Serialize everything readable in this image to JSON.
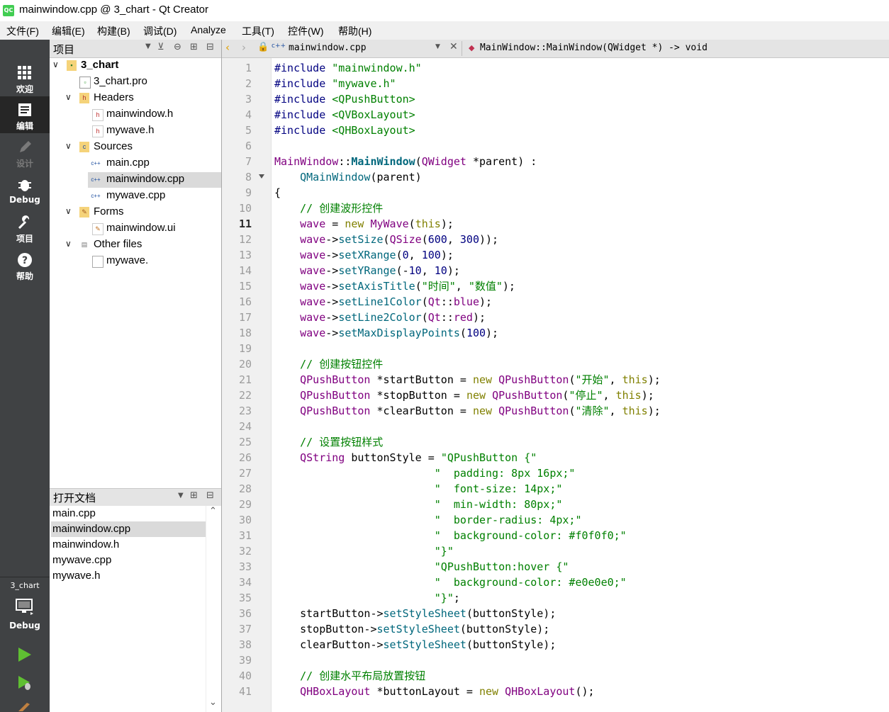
{
  "window": {
    "title": "mainwindow.cpp @ 3_chart - Qt Creator",
    "app_icon": "QC"
  },
  "menu": [
    "文件(F)",
    "编辑(E)",
    "构建(B)",
    "调试(D)",
    "Analyze",
    "工具(T)",
    "控件(W)",
    "帮助(H)"
  ],
  "modes": [
    {
      "label": "欢迎",
      "icon": "grid-icon"
    },
    {
      "label": "编辑",
      "icon": "edit-doc-icon",
      "active": true
    },
    {
      "label": "设计",
      "icon": "pencil-icon",
      "disabled": true
    },
    {
      "label": "Debug",
      "icon": "bug-icon"
    },
    {
      "label": "项目",
      "icon": "wrench-icon"
    },
    {
      "label": "帮助",
      "icon": "help-icon"
    }
  ],
  "kit": {
    "project": "3_chart",
    "build_config": "Debug"
  },
  "project_pane": {
    "title": "项目"
  },
  "tree": [
    {
      "label": "3_chart",
      "type": "project",
      "expanded": true
    },
    {
      "label": "3_chart.pro",
      "type": "pro"
    },
    {
      "label": "Headers",
      "type": "folder",
      "expanded": true
    },
    {
      "label": "mainwindow.h",
      "type": "h"
    },
    {
      "label": "mywave.h",
      "type": "h"
    },
    {
      "label": "Sources",
      "type": "folder",
      "expanded": true
    },
    {
      "label": "main.cpp",
      "type": "cpp"
    },
    {
      "label": "mainwindow.cpp",
      "type": "cpp",
      "selected": true
    },
    {
      "label": "mywave.cpp",
      "type": "cpp"
    },
    {
      "label": "Forms",
      "type": "folder",
      "expanded": true
    },
    {
      "label": "mainwindow.ui",
      "type": "ui"
    },
    {
      "label": "Other files",
      "type": "folder",
      "expanded": true
    },
    {
      "label": "mywave.",
      "type": "file"
    }
  ],
  "open_docs": {
    "title": "打开文档",
    "items": [
      "main.cpp",
      "mainwindow.cpp",
      "mainwindow.h",
      "mywave.cpp",
      "mywave.h"
    ],
    "selected": "mainwindow.cpp"
  },
  "editor": {
    "file": "mainwindow.cpp",
    "symbol": "MainWindow::MainWindow(QWidget *) -> void",
    "current_line": 11,
    "lines": [
      {
        "n": "1",
        "s": [
          [
            "pp",
            "#include "
          ],
          [
            "st",
            "\"mainwindow.h\""
          ]
        ]
      },
      {
        "n": "2",
        "s": [
          [
            "pp",
            "#include "
          ],
          [
            "st",
            "\"mywave.h\""
          ]
        ]
      },
      {
        "n": "3",
        "s": [
          [
            "pp",
            "#include "
          ],
          [
            "st",
            "<QPushButton>"
          ]
        ]
      },
      {
        "n": "4",
        "s": [
          [
            "pp",
            "#include "
          ],
          [
            "st",
            "<QVBoxLayout>"
          ]
        ]
      },
      {
        "n": "5",
        "s": [
          [
            "pp",
            "#include "
          ],
          [
            "st",
            "<QHBoxLayout>"
          ]
        ]
      },
      {
        "n": "6",
        "s": []
      },
      {
        "n": "7",
        "s": [
          [
            "tp",
            "MainWindow"
          ],
          [
            "",
            "::"
          ],
          [
            "bf",
            "MainWindow"
          ],
          [
            "",
            "("
          ],
          [
            "tp",
            "QWidget"
          ],
          [
            "",
            " *"
          ],
          [
            "",
            "parent"
          ],
          [
            "",
            ") :"
          ]
        ]
      },
      {
        "n": "8",
        "s": [
          [
            "",
            "    "
          ],
          [
            "fn",
            "QMainWindow"
          ],
          [
            "",
            "(parent)"
          ]
        ]
      },
      {
        "n": "9",
        "s": [
          [
            "",
            "{"
          ]
        ]
      },
      {
        "n": "10",
        "s": [
          [
            "",
            "    "
          ],
          [
            "cm",
            "// 创建波形控件"
          ]
        ]
      },
      {
        "n": "11",
        "s": [
          [
            "",
            "    "
          ],
          [
            "dt",
            "wave"
          ],
          [
            "",
            " = "
          ],
          [
            "kw",
            "new"
          ],
          [
            "",
            " "
          ],
          [
            "tp",
            "MyWave"
          ],
          [
            "",
            "("
          ],
          [
            "kw",
            "this"
          ],
          [
            "",
            ");"
          ]
        ]
      },
      {
        "n": "12",
        "s": [
          [
            "",
            "    "
          ],
          [
            "dt",
            "wave"
          ],
          [
            "",
            "->"
          ],
          [
            "fn",
            "setSize"
          ],
          [
            "",
            "("
          ],
          [
            "tp",
            "QSize"
          ],
          [
            "",
            "("
          ],
          [
            "nm",
            "600"
          ],
          [
            "",
            ", "
          ],
          [
            "nm",
            "300"
          ],
          [
            "",
            "));"
          ]
        ]
      },
      {
        "n": "13",
        "s": [
          [
            "",
            "    "
          ],
          [
            "dt",
            "wave"
          ],
          [
            "",
            "->"
          ],
          [
            "fn",
            "setXRange"
          ],
          [
            "",
            "("
          ],
          [
            "nm",
            "0"
          ],
          [
            "",
            ", "
          ],
          [
            "nm",
            "100"
          ],
          [
            "",
            ");"
          ]
        ]
      },
      {
        "n": "14",
        "s": [
          [
            "",
            "    "
          ],
          [
            "dt",
            "wave"
          ],
          [
            "",
            "->"
          ],
          [
            "fn",
            "setYRange"
          ],
          [
            "",
            "(-"
          ],
          [
            "nm",
            "10"
          ],
          [
            "",
            ", "
          ],
          [
            "nm",
            "10"
          ],
          [
            "",
            ");"
          ]
        ]
      },
      {
        "n": "15",
        "s": [
          [
            "",
            "    "
          ],
          [
            "dt",
            "wave"
          ],
          [
            "",
            "->"
          ],
          [
            "fn",
            "setAxisTitle"
          ],
          [
            "",
            "("
          ],
          [
            "st",
            "\"时间\""
          ],
          [
            "",
            ", "
          ],
          [
            "st",
            "\"数值\""
          ],
          [
            "",
            ");"
          ]
        ]
      },
      {
        "n": "16",
        "s": [
          [
            "",
            "    "
          ],
          [
            "dt",
            "wave"
          ],
          [
            "",
            "->"
          ],
          [
            "fn",
            "setLine1Color"
          ],
          [
            "",
            "("
          ],
          [
            "tp",
            "Qt"
          ],
          [
            "",
            "::"
          ],
          [
            "en",
            "blue"
          ],
          [
            "",
            ");"
          ]
        ]
      },
      {
        "n": "17",
        "s": [
          [
            "",
            "    "
          ],
          [
            "dt",
            "wave"
          ],
          [
            "",
            "->"
          ],
          [
            "fn",
            "setLine2Color"
          ],
          [
            "",
            "("
          ],
          [
            "tp",
            "Qt"
          ],
          [
            "",
            "::"
          ],
          [
            "en",
            "red"
          ],
          [
            "",
            ");"
          ]
        ]
      },
      {
        "n": "18",
        "s": [
          [
            "",
            "    "
          ],
          [
            "dt",
            "wave"
          ],
          [
            "",
            "->"
          ],
          [
            "fn",
            "setMaxDisplayPoints"
          ],
          [
            "",
            "("
          ],
          [
            "nm",
            "100"
          ],
          [
            "",
            ");"
          ]
        ]
      },
      {
        "n": "19",
        "s": []
      },
      {
        "n": "20",
        "s": [
          [
            "",
            "    "
          ],
          [
            "cm",
            "// 创建按钮控件"
          ]
        ]
      },
      {
        "n": "21",
        "s": [
          [
            "",
            "    "
          ],
          [
            "tp",
            "QPushButton"
          ],
          [
            "",
            " *startButton = "
          ],
          [
            "kw",
            "new"
          ],
          [
            "",
            " "
          ],
          [
            "tp",
            "QPushButton"
          ],
          [
            "",
            "("
          ],
          [
            "st",
            "\"开始\""
          ],
          [
            "",
            ", "
          ],
          [
            "kw",
            "this"
          ],
          [
            "",
            ");"
          ]
        ]
      },
      {
        "n": "22",
        "s": [
          [
            "",
            "    "
          ],
          [
            "tp",
            "QPushButton"
          ],
          [
            "",
            " *stopButton = "
          ],
          [
            "kw",
            "new"
          ],
          [
            "",
            " "
          ],
          [
            "tp",
            "QPushButton"
          ],
          [
            "",
            "("
          ],
          [
            "st",
            "\"停止\""
          ],
          [
            "",
            ", "
          ],
          [
            "kw",
            "this"
          ],
          [
            "",
            ");"
          ]
        ]
      },
      {
        "n": "23",
        "s": [
          [
            "",
            "    "
          ],
          [
            "tp",
            "QPushButton"
          ],
          [
            "",
            " *clearButton = "
          ],
          [
            "kw",
            "new"
          ],
          [
            "",
            " "
          ],
          [
            "tp",
            "QPushButton"
          ],
          [
            "",
            "("
          ],
          [
            "st",
            "\"清除\""
          ],
          [
            "",
            ", "
          ],
          [
            "kw",
            "this"
          ],
          [
            "",
            ");"
          ]
        ]
      },
      {
        "n": "24",
        "s": []
      },
      {
        "n": "25",
        "s": [
          [
            "",
            "    "
          ],
          [
            "cm",
            "// 设置按钮样式"
          ]
        ]
      },
      {
        "n": "26",
        "s": [
          [
            "",
            "    "
          ],
          [
            "tp",
            "QString"
          ],
          [
            "",
            " buttonStyle = "
          ],
          [
            "st",
            "\"QPushButton {\""
          ]
        ]
      },
      {
        "n": "27",
        "s": [
          [
            "",
            "                         "
          ],
          [
            "st",
            "\"  padding: 8px 16px;\""
          ]
        ]
      },
      {
        "n": "28",
        "s": [
          [
            "",
            "                         "
          ],
          [
            "st",
            "\"  font-size: 14px;\""
          ]
        ]
      },
      {
        "n": "29",
        "s": [
          [
            "",
            "                         "
          ],
          [
            "st",
            "\"  min-width: 80px;\""
          ]
        ]
      },
      {
        "n": "30",
        "s": [
          [
            "",
            "                         "
          ],
          [
            "st",
            "\"  border-radius: 4px;\""
          ]
        ]
      },
      {
        "n": "31",
        "s": [
          [
            "",
            "                         "
          ],
          [
            "st",
            "\"  background-color: #f0f0f0;\""
          ]
        ]
      },
      {
        "n": "32",
        "s": [
          [
            "",
            "                         "
          ],
          [
            "st",
            "\"}\""
          ]
        ]
      },
      {
        "n": "33",
        "s": [
          [
            "",
            "                         "
          ],
          [
            "st",
            "\"QPushButton:hover {\""
          ]
        ]
      },
      {
        "n": "34",
        "s": [
          [
            "",
            "                         "
          ],
          [
            "st",
            "\"  background-color: #e0e0e0;\""
          ]
        ]
      },
      {
        "n": "35",
        "s": [
          [
            "",
            "                         "
          ],
          [
            "st",
            "\"}\""
          ],
          [
            "",
            ";"
          ]
        ]
      },
      {
        "n": "36",
        "s": [
          [
            "",
            "    startButton->"
          ],
          [
            "fn",
            "setStyleSheet"
          ],
          [
            "",
            "(buttonStyle);"
          ]
        ]
      },
      {
        "n": "37",
        "s": [
          [
            "",
            "    stopButton->"
          ],
          [
            "fn",
            "setStyleSheet"
          ],
          [
            "",
            "(buttonStyle);"
          ]
        ]
      },
      {
        "n": "38",
        "s": [
          [
            "",
            "    clearButton->"
          ],
          [
            "fn",
            "setStyleSheet"
          ],
          [
            "",
            "(buttonStyle);"
          ]
        ]
      },
      {
        "n": "39",
        "s": []
      },
      {
        "n": "40",
        "s": [
          [
            "",
            "    "
          ],
          [
            "cm",
            "// 创建水平布局放置按钮"
          ]
        ]
      },
      {
        "n": "41",
        "s": [
          [
            "",
            "    "
          ],
          [
            "tp",
            "QHBoxLayout"
          ],
          [
            "",
            " *buttonLayout = "
          ],
          [
            "kw",
            "new"
          ],
          [
            "",
            " "
          ],
          [
            "tp",
            "QHBoxLayout"
          ],
          [
            "",
            "();"
          ]
        ]
      }
    ]
  },
  "colors": {
    "accent": "#41cd52",
    "sidebar": "#404244",
    "keyword": "#808000",
    "string": "#008000"
  }
}
